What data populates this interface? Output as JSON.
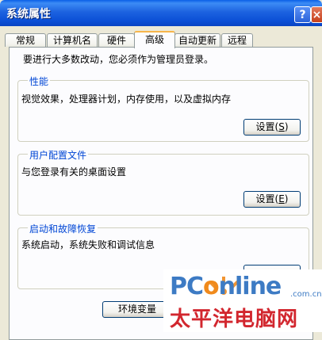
{
  "window": {
    "title": "系统属性",
    "help_glyph": "?",
    "close_glyph": "×"
  },
  "tabs": [
    {
      "label": "常规"
    },
    {
      "label": "计算机名"
    },
    {
      "label": "硬件"
    },
    {
      "label": "高级",
      "active": true
    },
    {
      "label": "自动更新"
    },
    {
      "label": "远程"
    }
  ],
  "notice": "要进行大多数改动，您必须作为管理员登录。",
  "performance": {
    "label": "性能",
    "description": "视觉效果，处理器计划，内存使用，以及虚拟内存",
    "button_label": "设置",
    "button_key": "S"
  },
  "user_profiles": {
    "label": "用户配置文件",
    "description": "与您登录有关的桌面设置",
    "button_label": "设置",
    "button_key": "E"
  },
  "startup_recovery": {
    "label": "启动和故障恢复",
    "description": "系统启动，系统失败和调试信息"
  },
  "env_button": {
    "label": "环境变量"
  },
  "watermark": {
    "brand_prefix": "PC",
    "brand_o": "o",
    "brand_suffix": "nline",
    "domain": ".com.cn",
    "chinese": "太平洋电脑网"
  }
}
